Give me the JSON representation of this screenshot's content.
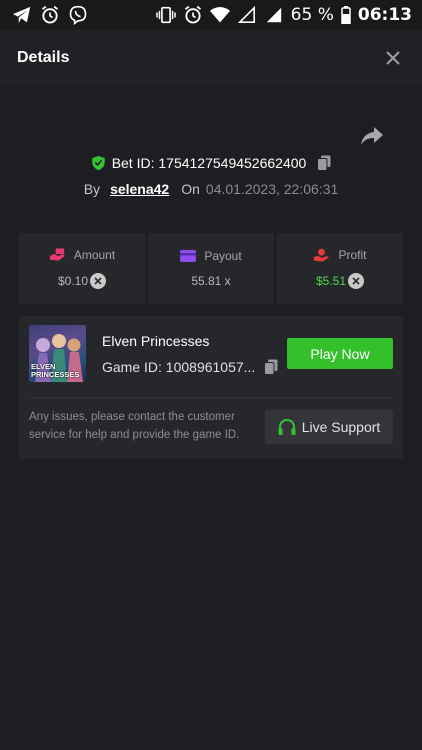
{
  "status_bar": {
    "battery_percent": "65 %",
    "time": "06:13",
    "left_icons": [
      "telegram-icon",
      "alarm-icon",
      "viber-icon"
    ],
    "right_icons": [
      "vibrate-icon",
      "alarm-icon",
      "wifi-icon",
      "signal-empty-icon",
      "signal-icon",
      "battery-icon"
    ]
  },
  "header": {
    "title": "Details",
    "close_icon": "close-icon"
  },
  "bet": {
    "label": "Bet ID: 1754127549452662400",
    "by_label": "By",
    "username": "selena42",
    "on_label": "On",
    "date": "04.01.2023, 22:06:31"
  },
  "stats": [
    {
      "label": "Amount",
      "value": "$0.10",
      "icon": "money-hand-icon",
      "icon_color": "#e8386f",
      "has_clear": true,
      "value_color": "#b7b8bb"
    },
    {
      "label": "Payout",
      "value": "55.81 x",
      "icon": "card-icon",
      "icon_color": "#8f4df0",
      "has_clear": false,
      "value_color": "#b7b8bb"
    },
    {
      "label": "Profit",
      "value": "$5.51",
      "icon": "profit-hand-icon",
      "icon_color": "#e83a3a",
      "has_clear": true,
      "value_color": "#4fd64f"
    }
  ],
  "game": {
    "name": "Elven Princesses",
    "thumb_text": "ELVEN PRINCESSES",
    "game_id": "Game ID: 1008961057...",
    "play_label": "Play Now",
    "issue_text": "Any issues, please contact the customer service for help and provide the game ID.",
    "support_label": "Live Support"
  },
  "colors": {
    "accent_green": "#33c02a",
    "bg": "#1d1e21",
    "card": "#26272b"
  }
}
